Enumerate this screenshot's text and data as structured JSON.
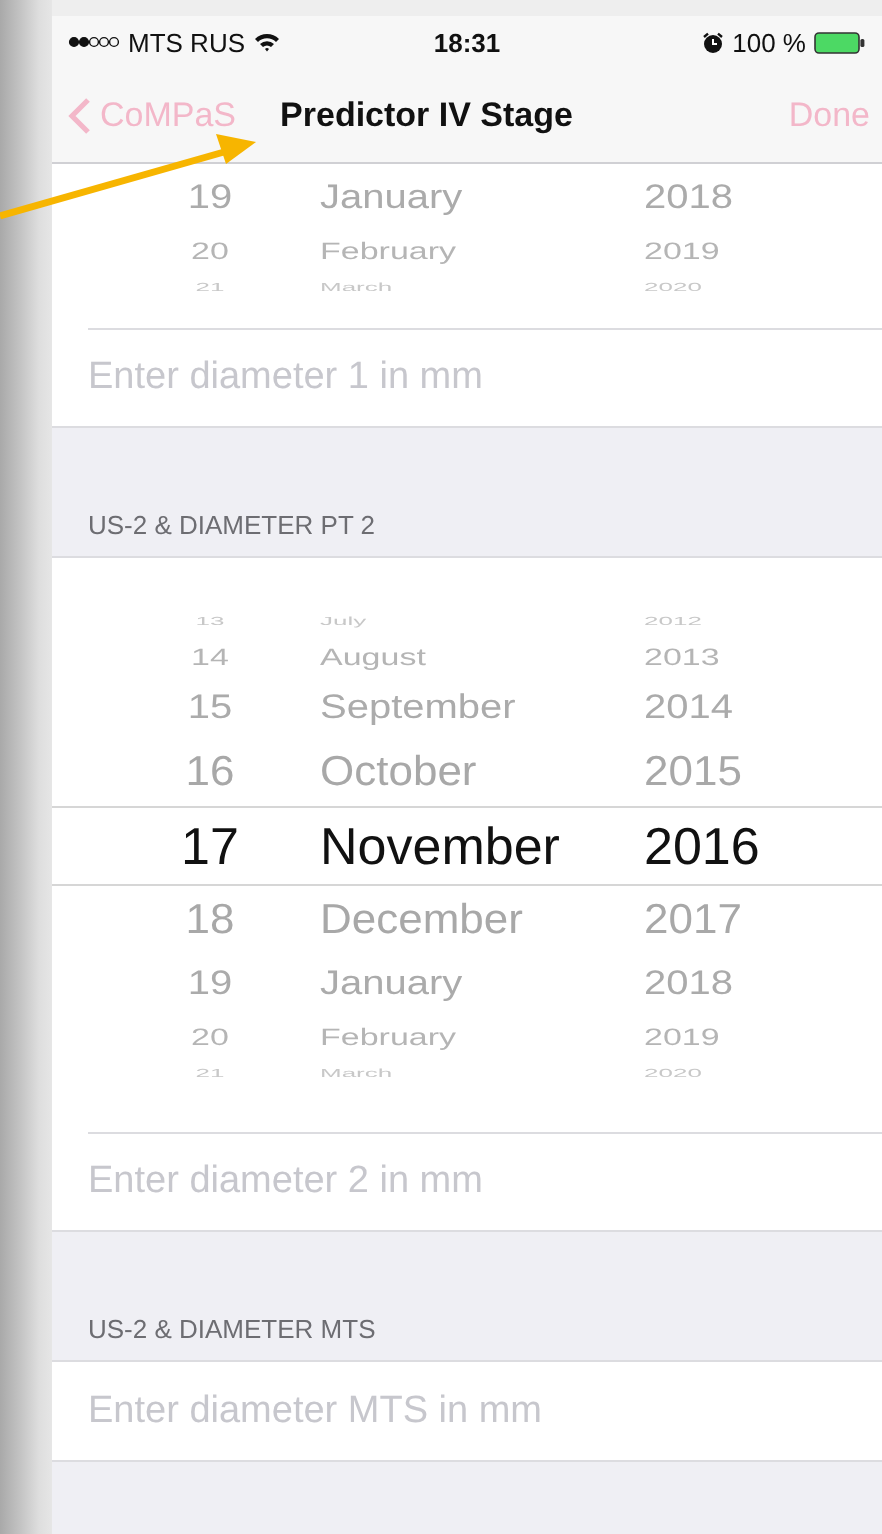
{
  "status_bar": {
    "carrier": "MTS RUS",
    "time": "18:31",
    "battery": "100 %"
  },
  "nav_bar": {
    "back": "CoMPaS",
    "title": "Predictor IV Stage",
    "done": "Done"
  },
  "sections": [
    {
      "picker": {
        "rows": [
          {
            "day": "19",
            "month": "January",
            "year": "2018",
            "selected": false
          },
          {
            "day": "20",
            "month": "February",
            "year": "2019",
            "selected": false
          },
          {
            "day": "21",
            "month": "March",
            "year": "2020",
            "selected": false
          }
        ]
      },
      "field": {
        "placeholder": "Enter diameter 1 in mm"
      }
    },
    {
      "header": "US-2 & DIAMETER PT 2",
      "picker": {
        "rows": [
          {
            "day": "13",
            "month": "July",
            "year": "2012",
            "selected": false
          },
          {
            "day": "14",
            "month": "August",
            "year": "2013",
            "selected": false
          },
          {
            "day": "15",
            "month": "September",
            "year": "2014",
            "selected": false
          },
          {
            "day": "16",
            "month": "October",
            "year": "2015",
            "selected": false
          },
          {
            "day": "17",
            "month": "November",
            "year": "2016",
            "selected": true
          },
          {
            "day": "18",
            "month": "December",
            "year": "2017",
            "selected": false
          },
          {
            "day": "19",
            "month": "January",
            "year": "2018",
            "selected": false
          },
          {
            "day": "20",
            "month": "February",
            "year": "2019",
            "selected": false
          },
          {
            "day": "21",
            "month": "March",
            "year": "2020",
            "selected": false
          }
        ]
      },
      "field": {
        "placeholder": "Enter diameter 2 in mm"
      }
    },
    {
      "header": "US-2 & DIAMETER MTS",
      "field": {
        "placeholder": "Enter diameter MTS in mm"
      }
    }
  ]
}
